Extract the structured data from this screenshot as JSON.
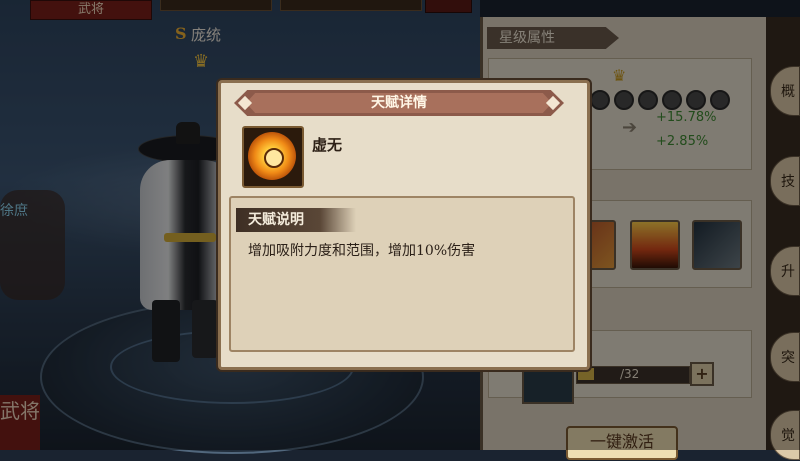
{
  "header": {
    "left_banner": "武将"
  },
  "hero": {
    "rank": "S",
    "name": "庞统",
    "crown_icon": "crown-icon"
  },
  "side": {
    "left_tag": "徐庶",
    "vertical_label": "武将"
  },
  "star_panel": {
    "title": "星级属性",
    "stats": {
      "old_1": "%",
      "old_2": "%",
      "new_1": "+15.78%",
      "new_2": "+2.85%"
    }
  },
  "material": {
    "count_text": "/32",
    "plus_label": "+"
  },
  "onekey_button": "一键激活",
  "tabs": [
    "概",
    "技",
    "升",
    "突",
    "觉"
  ],
  "modal": {
    "title": "天赋详情",
    "talent_name": "虚无",
    "section_title": "天赋说明",
    "description": "增加吸附力度和范围，增加10%伤害"
  },
  "colors": {
    "accent_gold": "#f3b334",
    "stat_green": "#3f8a33",
    "ribbon_red": "#8c5a4a"
  }
}
